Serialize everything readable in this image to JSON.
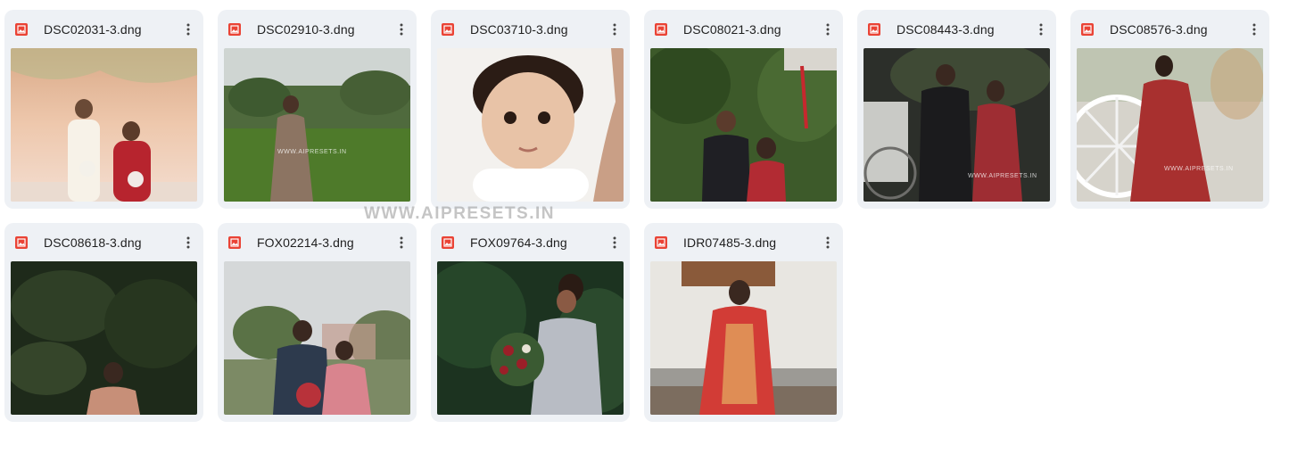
{
  "files": [
    {
      "name": "DSC02031-3.dng",
      "thumb": "couple-floral-backdrop"
    },
    {
      "name": "DSC02910-3.dng",
      "thumb": "woman-on-lawn"
    },
    {
      "name": "DSC03710-3.dng",
      "thumb": "baby-portrait"
    },
    {
      "name": "DSC08021-3.dng",
      "thumb": "couple-in-greenery"
    },
    {
      "name": "DSC08443-3.dng",
      "thumb": "couple-by-carriage"
    },
    {
      "name": "DSC08576-3.dng",
      "thumb": "bride-by-wheel"
    },
    {
      "name": "DSC08618-3.dng",
      "thumb": "bride-in-leaves"
    },
    {
      "name": "FOX02214-3.dng",
      "thumb": "couple-with-bouquet"
    },
    {
      "name": "FOX09764-3.dng",
      "thumb": "bride-with-bouquet"
    },
    {
      "name": "IDR07485-3.dng",
      "thumb": "bride-seated-red-saree"
    }
  ],
  "watermarks": {
    "overlay": "WWW.AIPRESETS.IN",
    "thumb_2": "WWW.AIPRESETS.IN",
    "thumb_5": "WWW.AIPRESETS.IN",
    "thumb_6": "WWW.AIPRESETS.IN"
  },
  "icons": {
    "file_type": "image-file-icon",
    "menu": "more-vertical-icon"
  },
  "colors": {
    "card_bg": "#eef1f5",
    "file_icon": "#ea4335",
    "text": "#1f1f1f"
  }
}
